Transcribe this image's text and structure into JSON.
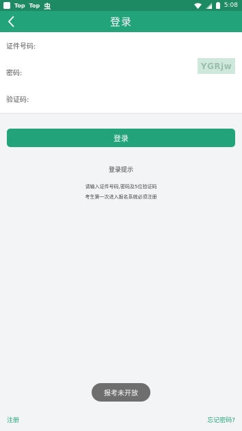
{
  "status_bar": {
    "app1": "Top",
    "app2": "Top",
    "app3": "虫",
    "time": "5:08",
    "icons": [
      "wifi-icon",
      "signal-icon",
      "battery-icon"
    ]
  },
  "navbar": {
    "title": "登录",
    "back_icon": "back-chevron-icon"
  },
  "form": {
    "id_label": "证件号码:",
    "id_value": "",
    "password_label": "密码:",
    "password_value": "",
    "captcha_label": "验证码:",
    "captcha_value": "",
    "captcha_text": "YGRjw"
  },
  "login_button": "登录",
  "tips": {
    "title": "登录提示",
    "line1": "请输入证件号码,密码及5位验证码",
    "line2": "考生第一次进入报名系统必须注册"
  },
  "toast": "报考未开放",
  "footer": {
    "register": "注册",
    "forgot": "忘记密码?"
  },
  "colors": {
    "primary": "#22a37a",
    "status_bar": "#1e8a63",
    "background": "#f3f4f6",
    "toast": "#6e6e6e"
  }
}
